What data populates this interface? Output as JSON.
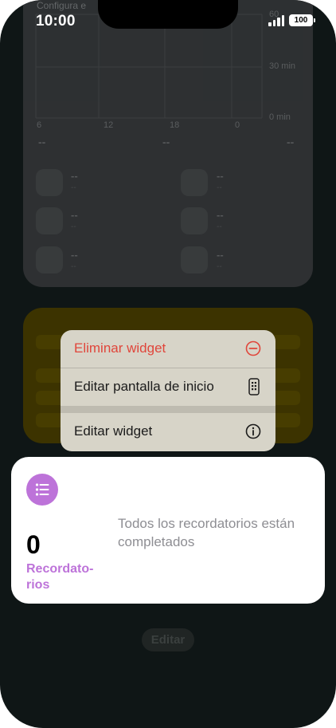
{
  "status_bar": {
    "time": "10:00",
    "battery": "100"
  },
  "widget_chart": {
    "title": "Configura e",
    "y_ticks": [
      "60",
      "30 min",
      "0 min"
    ],
    "x_ticks": [
      "6",
      "12",
      "18",
      "0"
    ],
    "summary": [
      "--",
      "--",
      "--"
    ],
    "items": [
      {
        "value": "--",
        "sub": "--"
      },
      {
        "value": "--",
        "sub": "--"
      },
      {
        "value": "--",
        "sub": "--"
      },
      {
        "value": "--",
        "sub": "--"
      },
      {
        "value": "--",
        "sub": "--"
      },
      {
        "value": "--",
        "sub": "--"
      }
    ]
  },
  "context_menu": {
    "remove": "Eliminar widget",
    "edit_home": "Editar pantalla de inicio",
    "edit_widget": "Editar widget",
    "icons": {
      "remove": "minus-circle-icon",
      "edit_home": "phone-apps-icon",
      "edit_widget": "info-circle-icon"
    },
    "danger_color": "#e0463b"
  },
  "reminders_widget": {
    "count": "0",
    "label": "Recordato-\nrios",
    "message": "Todos los recordatorios están completados",
    "accent_color": "#bd73d9",
    "icon": "list-bullet-icon"
  },
  "edit_button": "Editar"
}
